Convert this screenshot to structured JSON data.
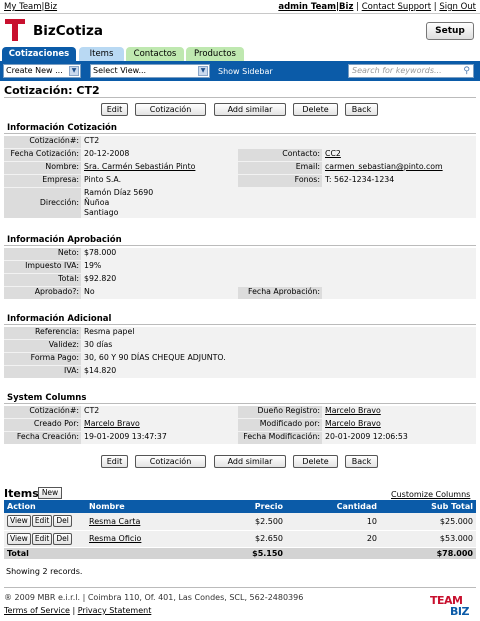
{
  "topbar": {
    "myteam": "My Team|Biz",
    "user": "admin Team|Biz",
    "contact": "Contact Support",
    "signout": "Sign Out"
  },
  "app": {
    "title": "BizCotiza",
    "setup_label": "Setup"
  },
  "tabs": [
    {
      "label": "Cotizaciones",
      "active": true
    },
    {
      "label": "Items"
    },
    {
      "label": "Contactos"
    },
    {
      "label": "Productos"
    }
  ],
  "toolbar": {
    "create": "Create New ...",
    "view": "Select View...",
    "sidebar": "Show Sidebar",
    "search_placeholder": "Search for keywords..."
  },
  "page": {
    "title": "Cotización: CT2"
  },
  "buttons": {
    "edit": "Edit",
    "cotizacion": "Cotización",
    "add_similar": "Add similar",
    "delete": "Delete",
    "back": "Back"
  },
  "info": {
    "heading": "Información Cotización",
    "l_num": "Cotización#:",
    "v_num": "CT2",
    "l_fecha": "Fecha Cotización:",
    "v_fecha": "20-12-2008",
    "l_nombre": "Nombre:",
    "v_nombre": "Sra. Carmén Sebastián Pinto",
    "l_empresa": "Empresa:",
    "v_empresa": "Pinto S.A.",
    "l_dir": "Dirección:",
    "v_dir1": "Ramón Díaz 5690",
    "v_dir2": "Ñuñoa",
    "v_dir3": "Santiago",
    "l_contacto": "Contacto:",
    "v_contacto": "CC2",
    "l_email": "Email:",
    "v_email": "carmen_sebastian@pinto.com",
    "l_fonos": "Fonos:",
    "v_fonos": "T: 562-1234-1234"
  },
  "aprob": {
    "heading": "Información Aprobación",
    "l_neto": "Neto:",
    "v_neto": "$78.000",
    "l_iva": "Impuesto IVA:",
    "v_iva": "19%",
    "l_total": "Total:",
    "v_total": "$92.820",
    "l_aprobado": "Aprobado?:",
    "v_aprobado": "No",
    "l_fecha": "Fecha Aprobación:",
    "v_fecha": ""
  },
  "adic": {
    "heading": "Información Adicional",
    "l_ref": "Referencia:",
    "v_ref": "Resma papel",
    "l_val": "Validez:",
    "v_val": "30 días",
    "l_pago": "Forma Pago:",
    "v_pago": "30, 60 Y 90 DÍAS CHEQUE ADJUNTO.",
    "l_iva": "IVA:",
    "v_iva": "$14.820"
  },
  "sys": {
    "heading": "System Columns",
    "l_num": "Cotización#:",
    "v_num": "CT2",
    "l_creado": "Creado Por:",
    "v_creado": "Marcelo Bravo",
    "l_fcrea": "Fecha Creación:",
    "v_fcrea": "19-01-2009 13:47:37",
    "l_dueno": "Dueño Registro:",
    "v_dueno": "Marcelo Bravo",
    "l_mod": "Modificado por:",
    "v_mod": "Marcelo Bravo",
    "l_fmod": "Fecha Modificación:",
    "v_fmod": "20-01-2009 12:06:53"
  },
  "items": {
    "heading": "Items",
    "new_label": "New",
    "customize": "Customize Columns",
    "columns": [
      "Action",
      "Nombre",
      "Precio",
      "Cantidad",
      "Sub Total"
    ],
    "actions": [
      "View",
      "Edit",
      "Del"
    ],
    "rows": [
      {
        "nombre": "Resma Carta",
        "precio": "$2.500",
        "cantidad": "10",
        "subtotal": "$25.000"
      },
      {
        "nombre": "Resma Oficio",
        "precio": "$2.650",
        "cantidad": "20",
        "subtotal": "$53.000"
      }
    ],
    "total_label": "Total",
    "total_precio": "$5.150",
    "total_subtotal": "$78.000",
    "showing": "Showing 2 records."
  },
  "footer": {
    "copyright": "® 2009 MBR e.i.r.l. | Coimbra 110, Of. 401, Las Condes, SCL, 562-2480396",
    "terms": "Terms of Service",
    "privacy": "Privacy Statement",
    "logo_top": "TEAM",
    "logo_bottom": "BIZ"
  },
  "colors": {
    "accent": "#0b5ba8",
    "logo_red": "#c8102e",
    "tab_active": "#0b5ba8",
    "tab_items": "#b9d9f3",
    "tab_green": "#bfe8b0"
  }
}
